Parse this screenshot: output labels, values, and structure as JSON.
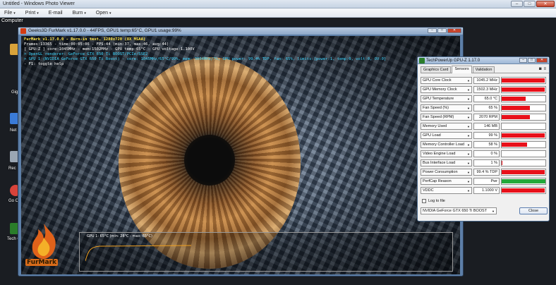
{
  "photo_viewer": {
    "title": "Untitled - Windows Photo Viewer",
    "menu": [
      {
        "label": "File",
        "arrow": "▾"
      },
      {
        "label": "Print",
        "arrow": "▾"
      },
      {
        "label": "E-mail",
        "arrow": ""
      },
      {
        "label": "Burn",
        "arrow": "▾"
      },
      {
        "label": "Open",
        "arrow": "▾"
      }
    ],
    "window_buttons": {
      "minimize": "–",
      "maximize": "□",
      "close": "✕"
    }
  },
  "desktop": {
    "label": "Computer",
    "icons": [
      {
        "name": "Gig",
        "color": "#d8a23a"
      },
      {
        "name": "Net",
        "color": "#3a7bd8"
      },
      {
        "name": "Rec",
        "color": "#9aa6b3"
      },
      {
        "name": "Go Chr",
        "color": "#d8433a"
      },
      {
        "name": "Tech GP",
        "color": "#2a7d2a"
      }
    ]
  },
  "furmark": {
    "title": "Geeks3D FurMark v1.17.0.0 - 44FPS, GPU1 temp:65°C, GPU1 usage:99%",
    "hud": {
      "line1": "FurMark v1.17.0.0 - Burn-in test, 1280x720 (8X MSAA)",
      "line2": "Frames:13365 - time:00:05:06 - FPS:44 (min:37, max:46, avg:44)",
      "line3": "[ GPU-Z ] core:1045MHz - mem:1502MHz - GPU temp:65°C - GPU voltage:1.100V",
      "line4": "> OpenGL renderer: GeForce GTX 650 Ti BOOST/PCIe/SSE2",
      "line5": "> GPU 1 (NVIDIA GeForce GTX 650 Ti Boost) - core: 1045MHz/65°C/99%, mem: 3004MHz/7%, GPU power: 99.4% TDP, fan: 65%, limits:[power:1, temp:0, volt:0, OV:0]",
      "line6": "- F1: toggle help"
    },
    "graph_label": "GPU 1: 65°C (min: 28°C - max: 65°C)",
    "logo_text": "FurMark",
    "window_buttons": {
      "minimize": "–",
      "maximize": "□",
      "close": "✕"
    }
  },
  "gpuz": {
    "title": "TechPowerUp GPU-Z 1.17.0",
    "tabs": [
      "Graphics Card",
      "Sensors",
      "Validation"
    ],
    "active_tab": "Sensors",
    "tab_icons": [
      "camera-icon",
      "menu-icon"
    ],
    "sensors": [
      {
        "name": "GPU Core Clock",
        "value": "1045.2 MHz",
        "level": 0.98,
        "color": "#e8101a"
      },
      {
        "name": "GPU Memory Clock",
        "value": "1502.3 MHz",
        "level": 0.98,
        "color": "#e8101a"
      },
      {
        "name": "GPU Temperature",
        "value": "65.0 °C",
        "level": 0.55,
        "color": "#e8101a"
      },
      {
        "name": "Fan Speed (%)",
        "value": "65 %",
        "level": 0.65,
        "color": "#e8101a"
      },
      {
        "name": "Fan Speed (RPM)",
        "value": "2070 RPM",
        "level": 0.65,
        "color": "#e8101a"
      },
      {
        "name": "Memory Used",
        "value": "146 MB",
        "level": 0.0,
        "color": "#e8101a"
      },
      {
        "name": "GPU Load",
        "value": "99 %",
        "level": 0.99,
        "color": "#e8101a"
      },
      {
        "name": "Memory Controller Load",
        "value": "58 %",
        "level": 0.58,
        "color": "#e8101a"
      },
      {
        "name": "Video Engine Load",
        "value": "0 %",
        "level": 0.0,
        "color": "#e8101a"
      },
      {
        "name": "Bus Interface Load",
        "value": "1 %",
        "level": 0.01,
        "color": "#e8101a"
      },
      {
        "name": "Power Consumption",
        "value": "99.4 % TDP",
        "level": 0.99,
        "color": "#e8101a"
      },
      {
        "name": "PerfCap Reason",
        "value": "Pwr",
        "level": 1.0,
        "color": "#22a83a"
      },
      {
        "name": "VDDC",
        "value": "1.1000 V",
        "level": 0.98,
        "color": "#e8101a"
      }
    ],
    "log_label": "Log to file",
    "gpu_select": "NVIDIA GeForce GTX 650 Ti BOOST",
    "close_label": "Close",
    "window_buttons": {
      "minimize": "–",
      "maximize": "□",
      "close": "✕"
    }
  }
}
